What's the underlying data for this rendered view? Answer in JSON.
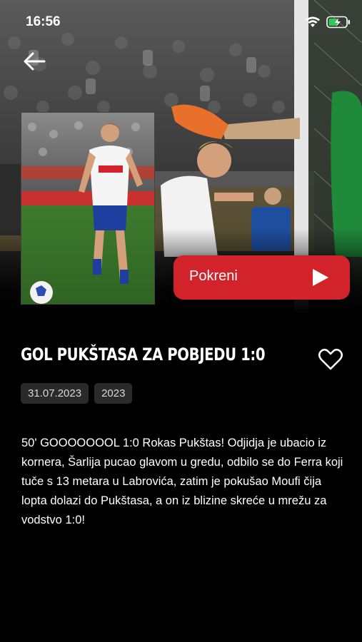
{
  "status_bar": {
    "time": "16:56"
  },
  "icons": {
    "back": "arrow-left-icon",
    "wifi": "wifi-icon",
    "battery": "battery-charging-icon",
    "play": "play-icon",
    "favorite": "heart-outline-icon"
  },
  "player": {
    "play_label": "Pokreni"
  },
  "video": {
    "title": "GOL PUKŠTASA ZA POBJEDU 1:0",
    "tags": [
      "31.07.2023",
      "2023"
    ],
    "description": "50' GOOOOOOOL 1:0 Rokas Pukštas! Odjidja je ubacio iz kornera, Šarlija pucao glavom u gredu, odbilo se do Ferra koji tuče s 13 metara u Labrovića, zatim je pokušao Moufi čija lopta dolazi do Pukštasa, a on iz blizine skreće u mrežu za vodstvo 1:0!"
  },
  "colors": {
    "accent": "#d2232a",
    "background": "#000000",
    "chip_bg": "#2a2a2a"
  }
}
